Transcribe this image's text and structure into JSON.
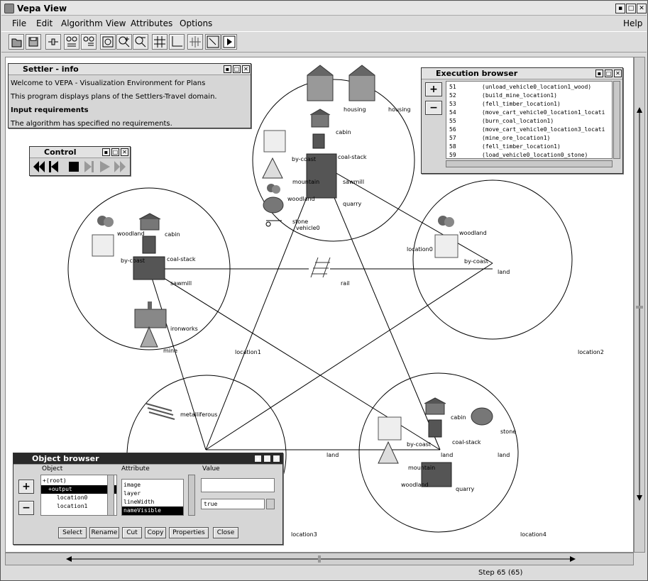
{
  "window": {
    "title": "Vepa View"
  },
  "menu": {
    "items": [
      "File",
      "Edit",
      "Algorithm",
      "View",
      "Attributes",
      "Options"
    ],
    "help": "Help"
  },
  "toolbar": {
    "icons": [
      "open-icon",
      "save-icon",
      "plug-icon",
      "graph-layout-icon",
      "graph-list-icon",
      "zoom-fit-icon",
      "zoom-in-icon",
      "zoom-out-icon",
      "grid-icon",
      "axes-icon",
      "crosshair-icon",
      "select-arrow-icon",
      "play-icon"
    ]
  },
  "settler": {
    "title": "Settler - info",
    "lines": [
      "Welcome to VEPA - Visualization Environment for Plans",
      "This program displays plans of the Settlers-Travel domain."
    ],
    "heading": "Input requirements",
    "requirement": "The algorithm has specified no requirements."
  },
  "control": {
    "title": "Control"
  },
  "exec": {
    "title": "Execution browser",
    "rows": [
      {
        "n": "51",
        "a": "(unload_vehicle0_location1_wood)"
      },
      {
        "n": "52",
        "a": "(build_mine_location1)"
      },
      {
        "n": "53",
        "a": "(fell_timber_location1)"
      },
      {
        "n": "54",
        "a": "(move_cart_vehicle0_location1_locati"
      },
      {
        "n": "55",
        "a": "(burn_coal_location1)"
      },
      {
        "n": "56",
        "a": "(move_cart_vehicle0_location3_locati"
      },
      {
        "n": "57",
        "a": "(mine_ore_location1)"
      },
      {
        "n": "58",
        "a": "(fell_timber_location1)"
      },
      {
        "n": "59",
        "a": "(load_vehicle0_location0_stone)"
      }
    ],
    "plus": "+",
    "minus": "−"
  },
  "objects": {
    "title": "Object browser",
    "col_object": "Object",
    "col_attribute": "Attribute",
    "col_value": "Value",
    "tree": [
      "+(root)",
      "+output",
      "location0",
      "location1"
    ],
    "attributes": [
      "image",
      "layer",
      "lineWidth",
      "nameVisible"
    ],
    "value_text": "",
    "value_select": "true",
    "buttons": [
      "Select",
      "Rename",
      "Cut",
      "Copy",
      "Properties",
      "Close"
    ],
    "plus": "+",
    "minus": "−"
  },
  "graph": {
    "labels": {
      "location0": "location0",
      "location1": "location1",
      "location2": "location2",
      "location3": "location3",
      "location4": "location4",
      "housing1": "housing",
      "housing2": "housing",
      "cabin": "cabin",
      "coal_stack": "coal-stack",
      "by_coast": "by-coast",
      "mountain": "mountain",
      "sawmill": "sawmill",
      "woodland": "woodland",
      "quarry": "quarry",
      "stone": "stone",
      "vehicle0": "vehicle0",
      "ironworks": "ironworks",
      "mine": "mine",
      "rail": "rail",
      "land": "land",
      "metalliferous": "metalliferous"
    }
  },
  "status": {
    "step": "Step 65 (65)"
  }
}
